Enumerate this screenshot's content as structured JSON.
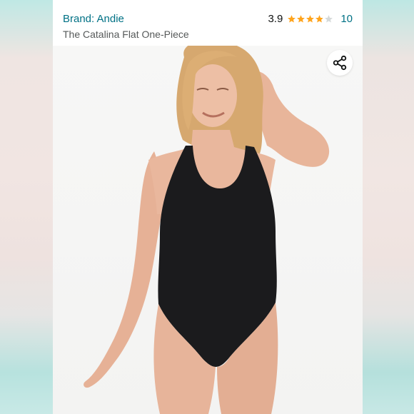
{
  "header": {
    "brand": "Brand: Andie",
    "title": "The Catalina Flat One-Piece",
    "rating_value": "3.9",
    "rating_stars": 3.9,
    "rating_count": "10"
  },
  "icons": {
    "share": "share-icon",
    "star": "star-icon"
  },
  "colors": {
    "link": "#007185",
    "star": "#ffa41c",
    "star_empty": "#d5d9d9",
    "swimsuit": "#1b1b1d",
    "skin": "#e8b59a",
    "hair": "#d8ad78"
  }
}
